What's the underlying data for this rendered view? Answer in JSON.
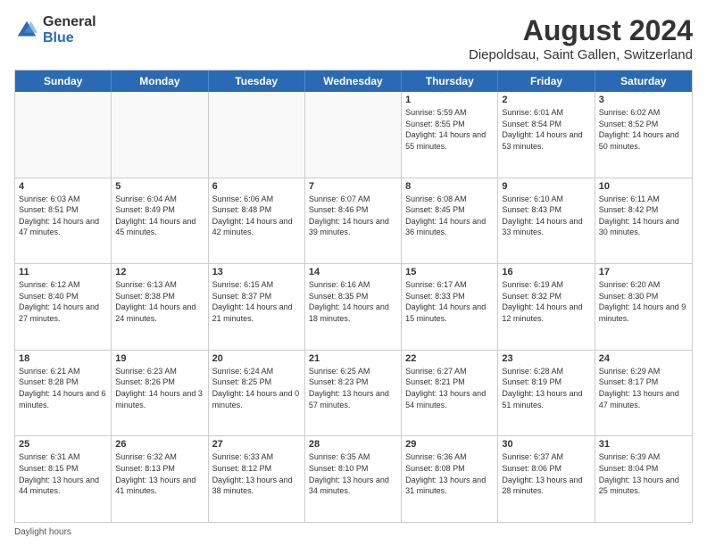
{
  "logo": {
    "general": "General",
    "blue": "Blue"
  },
  "title": "August 2024",
  "subtitle": "Diepoldsau, Saint Gallen, Switzerland",
  "days_of_week": [
    "Sunday",
    "Monday",
    "Tuesday",
    "Wednesday",
    "Thursday",
    "Friday",
    "Saturday"
  ],
  "footer": "Daylight hours",
  "weeks": [
    [
      {
        "day": "",
        "info": ""
      },
      {
        "day": "",
        "info": ""
      },
      {
        "day": "",
        "info": ""
      },
      {
        "day": "",
        "info": ""
      },
      {
        "day": "1",
        "info": "Sunrise: 5:59 AM\nSunset: 8:55 PM\nDaylight: 14 hours\nand 55 minutes."
      },
      {
        "day": "2",
        "info": "Sunrise: 6:01 AM\nSunset: 8:54 PM\nDaylight: 14 hours\nand 53 minutes."
      },
      {
        "day": "3",
        "info": "Sunrise: 6:02 AM\nSunset: 8:52 PM\nDaylight: 14 hours\nand 50 minutes."
      }
    ],
    [
      {
        "day": "4",
        "info": "Sunrise: 6:03 AM\nSunset: 8:51 PM\nDaylight: 14 hours\nand 47 minutes."
      },
      {
        "day": "5",
        "info": "Sunrise: 6:04 AM\nSunset: 8:49 PM\nDaylight: 14 hours\nand 45 minutes."
      },
      {
        "day": "6",
        "info": "Sunrise: 6:06 AM\nSunset: 8:48 PM\nDaylight: 14 hours\nand 42 minutes."
      },
      {
        "day": "7",
        "info": "Sunrise: 6:07 AM\nSunset: 8:46 PM\nDaylight: 14 hours\nand 39 minutes."
      },
      {
        "day": "8",
        "info": "Sunrise: 6:08 AM\nSunset: 8:45 PM\nDaylight: 14 hours\nand 36 minutes."
      },
      {
        "day": "9",
        "info": "Sunrise: 6:10 AM\nSunset: 8:43 PM\nDaylight: 14 hours\nand 33 minutes."
      },
      {
        "day": "10",
        "info": "Sunrise: 6:11 AM\nSunset: 8:42 PM\nDaylight: 14 hours\nand 30 minutes."
      }
    ],
    [
      {
        "day": "11",
        "info": "Sunrise: 6:12 AM\nSunset: 8:40 PM\nDaylight: 14 hours\nand 27 minutes."
      },
      {
        "day": "12",
        "info": "Sunrise: 6:13 AM\nSunset: 8:38 PM\nDaylight: 14 hours\nand 24 minutes."
      },
      {
        "day": "13",
        "info": "Sunrise: 6:15 AM\nSunset: 8:37 PM\nDaylight: 14 hours\nand 21 minutes."
      },
      {
        "day": "14",
        "info": "Sunrise: 6:16 AM\nSunset: 8:35 PM\nDaylight: 14 hours\nand 18 minutes."
      },
      {
        "day": "15",
        "info": "Sunrise: 6:17 AM\nSunset: 8:33 PM\nDaylight: 14 hours\nand 15 minutes."
      },
      {
        "day": "16",
        "info": "Sunrise: 6:19 AM\nSunset: 8:32 PM\nDaylight: 14 hours\nand 12 minutes."
      },
      {
        "day": "17",
        "info": "Sunrise: 6:20 AM\nSunset: 8:30 PM\nDaylight: 14 hours\nand 9 minutes."
      }
    ],
    [
      {
        "day": "18",
        "info": "Sunrise: 6:21 AM\nSunset: 8:28 PM\nDaylight: 14 hours\nand 6 minutes."
      },
      {
        "day": "19",
        "info": "Sunrise: 6:23 AM\nSunset: 8:26 PM\nDaylight: 14 hours\nand 3 minutes."
      },
      {
        "day": "20",
        "info": "Sunrise: 6:24 AM\nSunset: 8:25 PM\nDaylight: 14 hours\nand 0 minutes."
      },
      {
        "day": "21",
        "info": "Sunrise: 6:25 AM\nSunset: 8:23 PM\nDaylight: 13 hours\nand 57 minutes."
      },
      {
        "day": "22",
        "info": "Sunrise: 6:27 AM\nSunset: 8:21 PM\nDaylight: 13 hours\nand 54 minutes."
      },
      {
        "day": "23",
        "info": "Sunrise: 6:28 AM\nSunset: 8:19 PM\nDaylight: 13 hours\nand 51 minutes."
      },
      {
        "day": "24",
        "info": "Sunrise: 6:29 AM\nSunset: 8:17 PM\nDaylight: 13 hours\nand 47 minutes."
      }
    ],
    [
      {
        "day": "25",
        "info": "Sunrise: 6:31 AM\nSunset: 8:15 PM\nDaylight: 13 hours\nand 44 minutes."
      },
      {
        "day": "26",
        "info": "Sunrise: 6:32 AM\nSunset: 8:13 PM\nDaylight: 13 hours\nand 41 minutes."
      },
      {
        "day": "27",
        "info": "Sunrise: 6:33 AM\nSunset: 8:12 PM\nDaylight: 13 hours\nand 38 minutes."
      },
      {
        "day": "28",
        "info": "Sunrise: 6:35 AM\nSunset: 8:10 PM\nDaylight: 13 hours\nand 34 minutes."
      },
      {
        "day": "29",
        "info": "Sunrise: 6:36 AM\nSunset: 8:08 PM\nDaylight: 13 hours\nand 31 minutes."
      },
      {
        "day": "30",
        "info": "Sunrise: 6:37 AM\nSunset: 8:06 PM\nDaylight: 13 hours\nand 28 minutes."
      },
      {
        "day": "31",
        "info": "Sunrise: 6:39 AM\nSunset: 8:04 PM\nDaylight: 13 hours\nand 25 minutes."
      }
    ]
  ]
}
